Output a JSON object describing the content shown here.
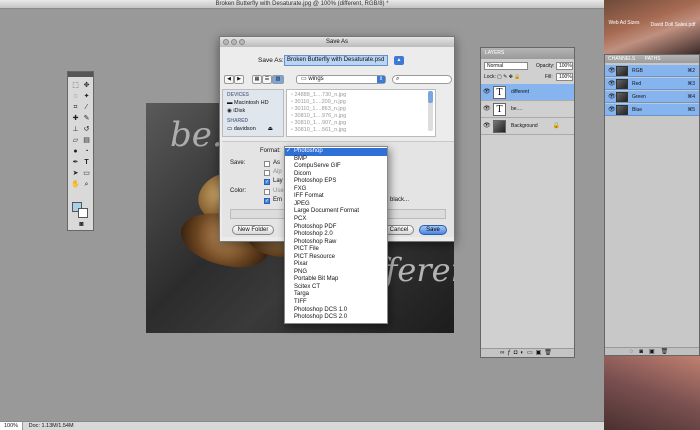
{
  "document": {
    "title": "Broken Butterfly with Desaturate.jpg @ 100% (different, RGB/8) *",
    "zoom": "100%",
    "doc_size": "Doc: 1.13M/1.54M",
    "image_text": [
      "be.",
      "different"
    ]
  },
  "tools_panel": {
    "tool_icons": [
      "marquee-icon",
      "move-icon",
      "lasso-icon",
      "magic-wand-icon",
      "crop-icon",
      "eyedropper-icon",
      "healing-icon",
      "brush-icon",
      "stamp-icon",
      "history-brush-icon",
      "eraser-icon",
      "gradient-icon",
      "blur-icon",
      "dodge-icon",
      "pen-icon",
      "type-icon",
      "path-select-icon",
      "shape-icon",
      "hand-icon",
      "zoom-icon"
    ],
    "type_tool_glyph": "T",
    "fg_color": "#a8d0e8",
    "bg_color": "#ffffff"
  },
  "save_dialog": {
    "title": "Save As",
    "save_as_label": "Save As:",
    "filename": "Broken Butterfly with Desaturate.psd",
    "folder": "wings",
    "sidebar": {
      "devices_header": "DEVICES",
      "devices": [
        "Macintosh HD",
        "iDisk"
      ],
      "shared_header": "SHARED",
      "shared": [
        "davidson"
      ]
    },
    "files": [
      "24888_1....730_n.jpg",
      "30110_1....209_n.jpg",
      "30110_1....863_n.jpg",
      "30810_1....976_n.jpg",
      "30810_1....907_n.jpg",
      "30810_1....561_n.jpg"
    ],
    "format_label": "Format:",
    "save_label": "Save:",
    "save_opts": [
      {
        "label": "As",
        "checked": false
      },
      {
        "label": "Alp",
        "checked": false
      },
      {
        "label": "Lay",
        "checked": true
      },
      {
        "label": "Use",
        "checked": false
      },
      {
        "label": "Em",
        "checked": true
      }
    ],
    "color_label": "Color:",
    "profile_suffix": "black...",
    "new_folder": "New Folder",
    "cancel": "Cancel",
    "save": "Save"
  },
  "format_menu": {
    "selected": "Photoshop",
    "items": [
      "Photoshop",
      "BMP",
      "CompuServe GIF",
      "Dicom",
      "Photoshop EPS",
      "FXG",
      "IFF Format",
      "JPEG",
      "Large Document Format",
      "PCX",
      "Photoshop PDF",
      "Photoshop 2.0",
      "Photoshop Raw",
      "PICT File",
      "PICT Resource",
      "Pixar",
      "PNG",
      "Portable Bit Map",
      "Scitex CT",
      "Targa",
      "TIFF",
      "Photoshop DCS 1.0",
      "Photoshop DCS 2.0"
    ]
  },
  "layers_panel": {
    "tab": "LAYERS",
    "blend_mode": "Normal",
    "opacity_label": "Opacity:",
    "opacity": "100%",
    "lock_label": "Lock:",
    "fill_label": "Fill:",
    "fill": "100%",
    "layers": [
      {
        "name": "different",
        "thumb": "T",
        "active": true
      },
      {
        "name": "be....",
        "thumb": "T",
        "active": false
      },
      {
        "name": "Background",
        "thumb": "",
        "active": false
      }
    ]
  },
  "channels_panel": {
    "tabs": [
      "CHANNELS",
      "PATHS"
    ],
    "channels": [
      {
        "name": "RGB",
        "key": "⌘2"
      },
      {
        "name": "Red",
        "key": "⌘3"
      },
      {
        "name": "Green",
        "key": "⌘4"
      },
      {
        "name": "Blue",
        "key": "⌘5"
      }
    ]
  },
  "desktop": {
    "icon_label": "Web Ad Sizes",
    "icon_label2": "David Doll Sales.pdf"
  }
}
